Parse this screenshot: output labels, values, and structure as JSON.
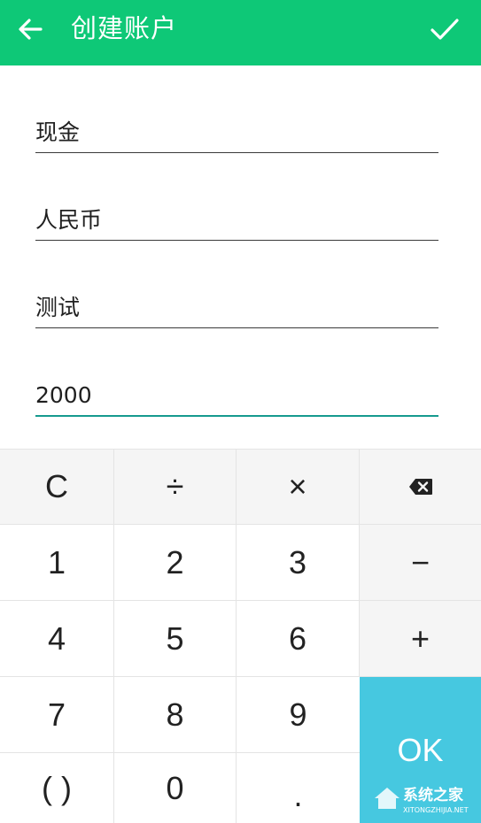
{
  "header": {
    "title": "创建账户",
    "back_icon": "arrow-left-icon",
    "confirm_icon": "check-icon",
    "background": "#0ec877"
  },
  "form": {
    "fields": [
      {
        "value": "现金"
      },
      {
        "value": "人民币"
      },
      {
        "value": "测试"
      },
      {
        "value": "2000"
      }
    ]
  },
  "keypad": {
    "clear": "C",
    "divide": "÷",
    "multiply": "×",
    "backspace_icon": "backspace-icon",
    "digits": [
      "1",
      "2",
      "3",
      "4",
      "5",
      "6",
      "7",
      "8",
      "9",
      "0"
    ],
    "minus": "−",
    "plus": "+",
    "parens": "( )",
    "dot": ".",
    "ok": "OK",
    "ok_color": "#46c8e0"
  },
  "watermark": {
    "name": "系统之家",
    "url": "XITONGZHIJIA.NET"
  }
}
